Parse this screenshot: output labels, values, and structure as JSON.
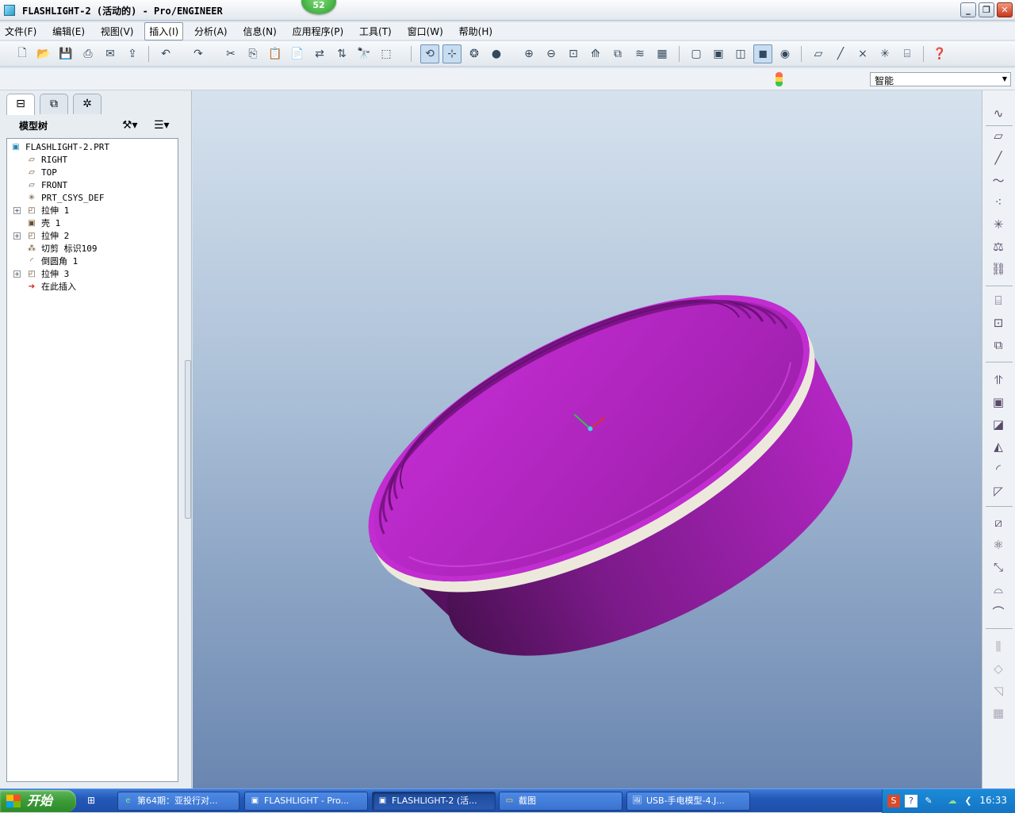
{
  "window": {
    "title": "FLASHLIGHT-2 (活动的) - Pro/ENGINEER",
    "badge": "52",
    "controls": {
      "minimize": "_",
      "restore": "❐",
      "close": "✕"
    }
  },
  "menu": [
    "文件(F)",
    "编辑(E)",
    "视图(V)",
    "插入(I)",
    "分析(A)",
    "信息(N)",
    "应用程序(P)",
    "工具(T)",
    "窗口(W)",
    "帮助(H)"
  ],
  "menu_active": "插入(I)",
  "filter": {
    "value": "智能"
  },
  "panel": {
    "tabs": [
      "model-tree-tab",
      "layers-tab",
      "favorites-tab"
    ],
    "header": "模型树"
  },
  "tree": {
    "root": "FLASHLIGHT-2.PRT",
    "items": [
      {
        "label": "RIGHT",
        "icon": "datum-plane-icon"
      },
      {
        "label": "TOP",
        "icon": "datum-plane-icon"
      },
      {
        "label": "FRONT",
        "icon": "datum-plane-icon"
      },
      {
        "label": "PRT_CSYS_DEF",
        "icon": "csys-icon"
      },
      {
        "label": "拉伸 1",
        "icon": "extrude-icon",
        "expandable": true
      },
      {
        "label": "壳 1",
        "icon": "shell-icon"
      },
      {
        "label": "拉伸 2",
        "icon": "extrude-icon",
        "expandable": true
      },
      {
        "label": "切剪 标识109",
        "icon": "cut-icon"
      },
      {
        "label": "倒圆角 1",
        "icon": "round-icon"
      },
      {
        "label": "拉伸 3",
        "icon": "extrude-icon",
        "expandable": true
      },
      {
        "label": "在此插入",
        "icon": "insert-here-arrow-icon"
      }
    ]
  },
  "model": {
    "body_color": "#a61fb4",
    "inner_color": "#c42ad3",
    "band_color": "#ece9dc"
  },
  "taskbar": {
    "start": "开始",
    "tasks": [
      {
        "label": "第64期：亚投行对..."
      },
      {
        "label": "FLASHLIGHT - Pro..."
      },
      {
        "label": "FLASHLIGHT-2 (活..."
      },
      {
        "label": "截图"
      },
      {
        "label": "USB-手电模型-4.J..."
      }
    ],
    "clock": "16:33"
  }
}
